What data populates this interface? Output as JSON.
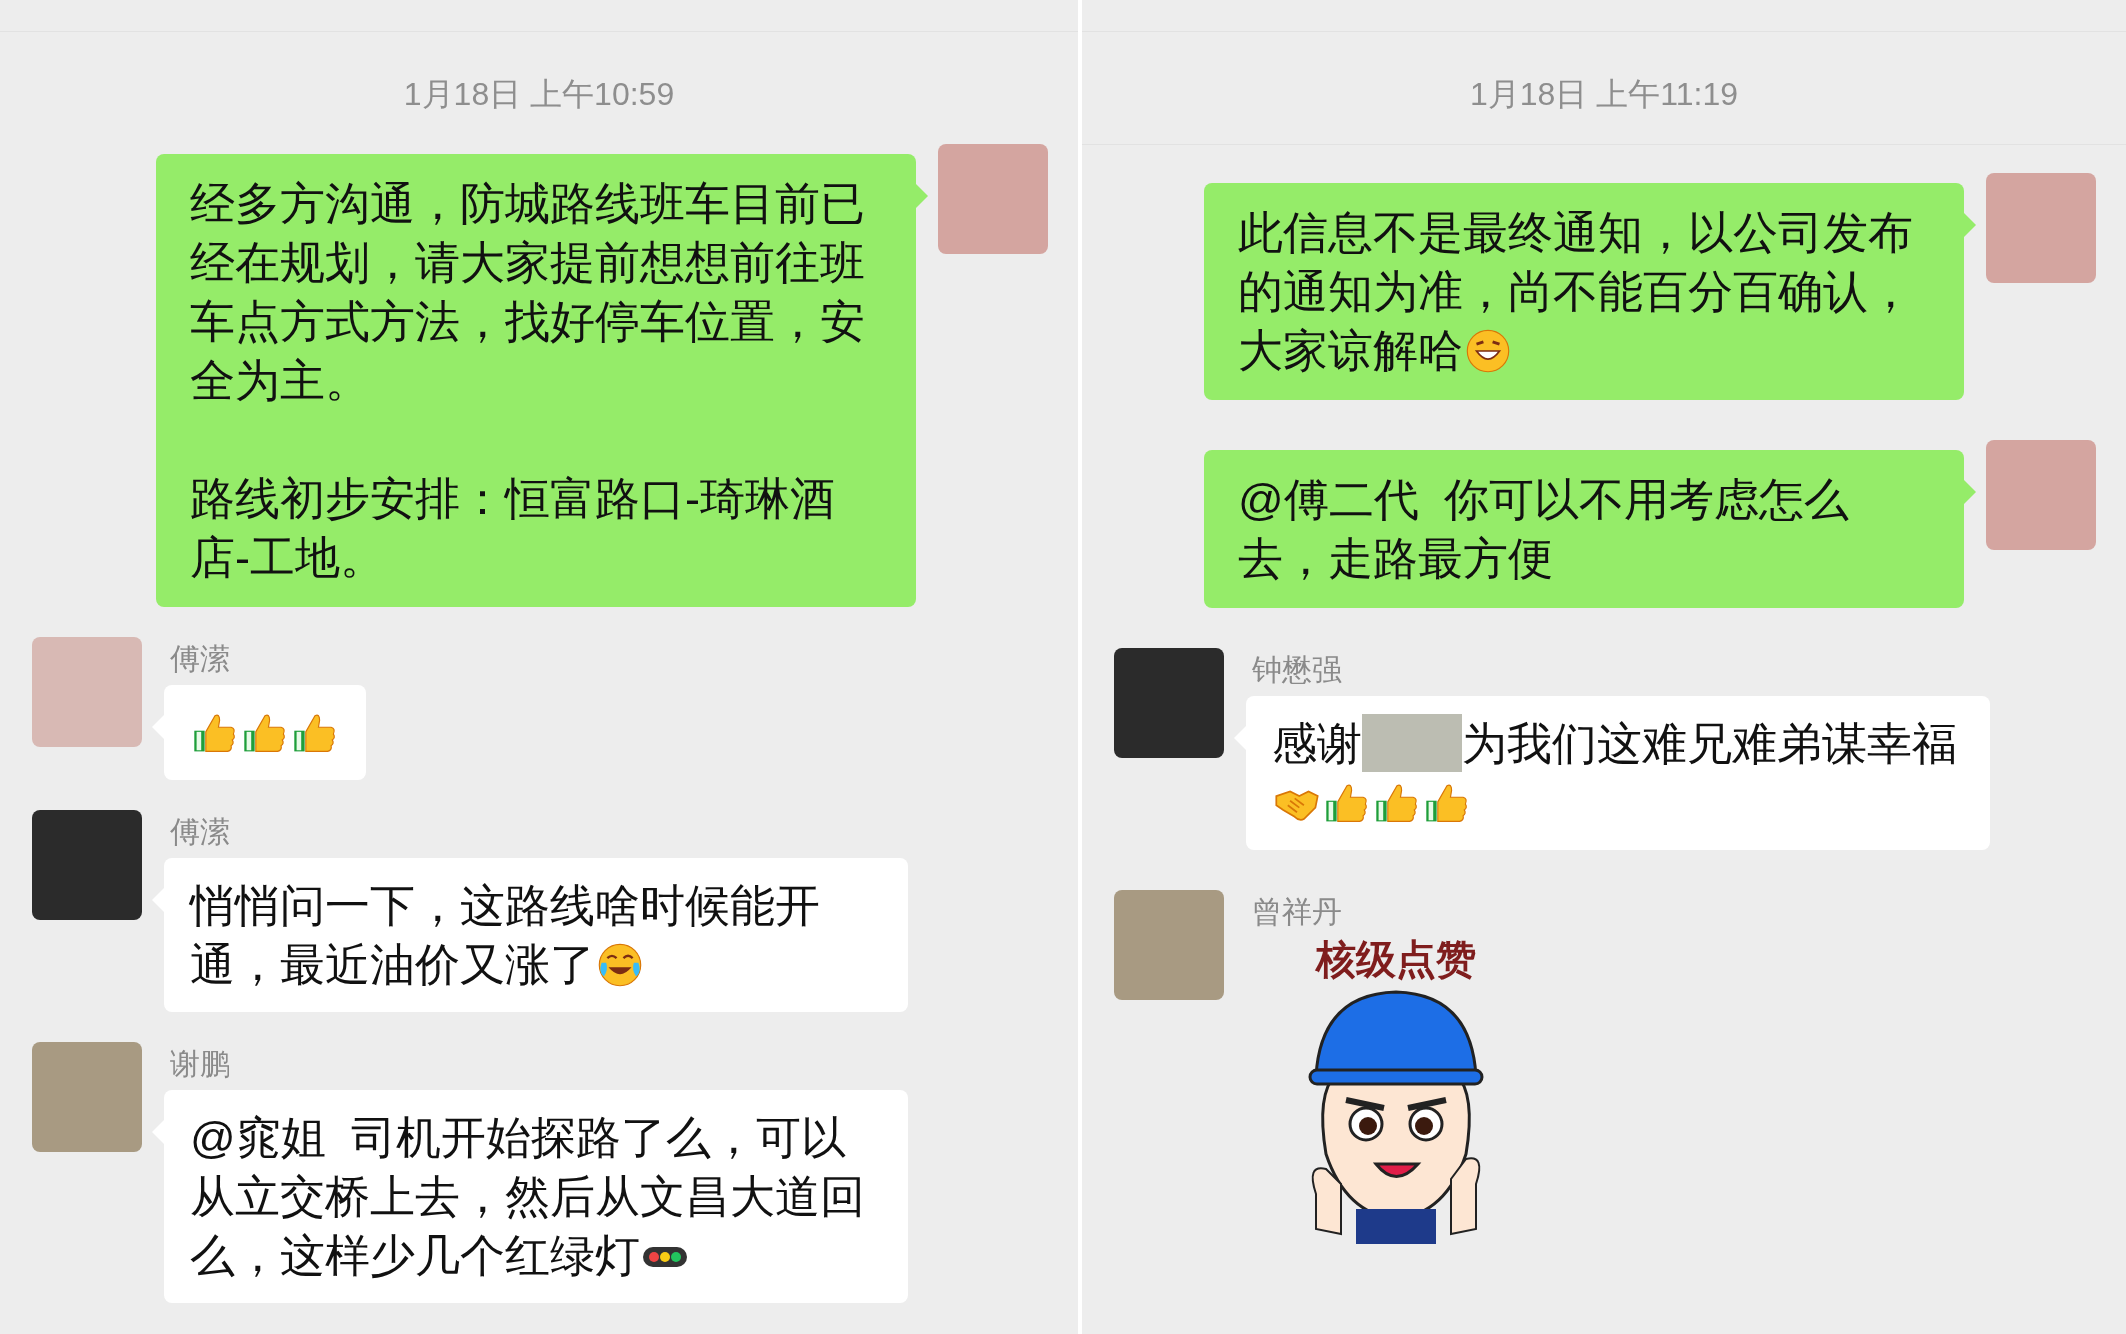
{
  "panels": [
    {
      "timestamp": "1月18日 上午10:59",
      "messages": [
        {
          "kind": "outgoing",
          "parts": [
            {
              "kind": "paragraph",
              "text": "经多方沟通，防城路线班车目前已经在规划，请大家提前想想前往班车点方式方法，找好停车位置，安全为主。"
            },
            {
              "kind": "paragraph",
              "text": "路线初步安排：恒富路口-琦琳酒店-工地。"
            }
          ]
        },
        {
          "kind": "incoming",
          "sender": "傅潆",
          "parts": [
            {
              "kind": "thumbs_up"
            },
            {
              "kind": "thumbs_up"
            },
            {
              "kind": "thumbs_up"
            }
          ]
        },
        {
          "kind": "incoming",
          "sender": "傅潆",
          "parts": [
            {
              "kind": "text",
              "text": "悄悄问一下，这路线啥时候能开"
            },
            {
              "kind": "text",
              "text": "通，最近油价又涨了"
            },
            {
              "kind": "laugh_cry"
            }
          ]
        },
        {
          "kind": "incoming",
          "sender": "谢鹏",
          "parts": [
            {
              "kind": "text",
              "text": "@窕姐  司机开始探路了么，可以从立交桥上去，然后从文昌大道回"
            },
            {
              "kind": "text",
              "text": "么，这样少几个红绿灯"
            },
            {
              "kind": "traffic_light"
            }
          ]
        }
      ]
    },
    {
      "timestamp": "1月18日 上午11:19",
      "messages": [
        {
          "kind": "outgoing",
          "parts": [
            {
              "kind": "text",
              "text": "此信息不是最终通知，以公司发布的通知为准，尚不能百分百确认，"
            },
            {
              "kind": "text",
              "text": "大家谅解哈"
            },
            {
              "kind": "grin"
            }
          ]
        },
        {
          "kind": "outgoing",
          "parts": [
            {
              "kind": "text",
              "text": "@傅二代  你可以不用考虑怎么去，走路最方便"
            }
          ]
        },
        {
          "kind": "incoming",
          "sender": "钟懋强",
          "parts": [
            {
              "kind": "text",
              "text": "感谢"
            },
            {
              "kind": "redacted"
            },
            {
              "kind": "text",
              "text": "为我们这难兄难弟谋幸福"
            },
            {
              "kind": "handshake"
            },
            {
              "kind": "thumbs_up"
            },
            {
              "kind": "thumbs_up"
            },
            {
              "kind": "thumbs_up"
            }
          ]
        },
        {
          "kind": "sticker",
          "sender": "曾祥丹",
          "caption": "核级点赞"
        }
      ]
    }
  ]
}
